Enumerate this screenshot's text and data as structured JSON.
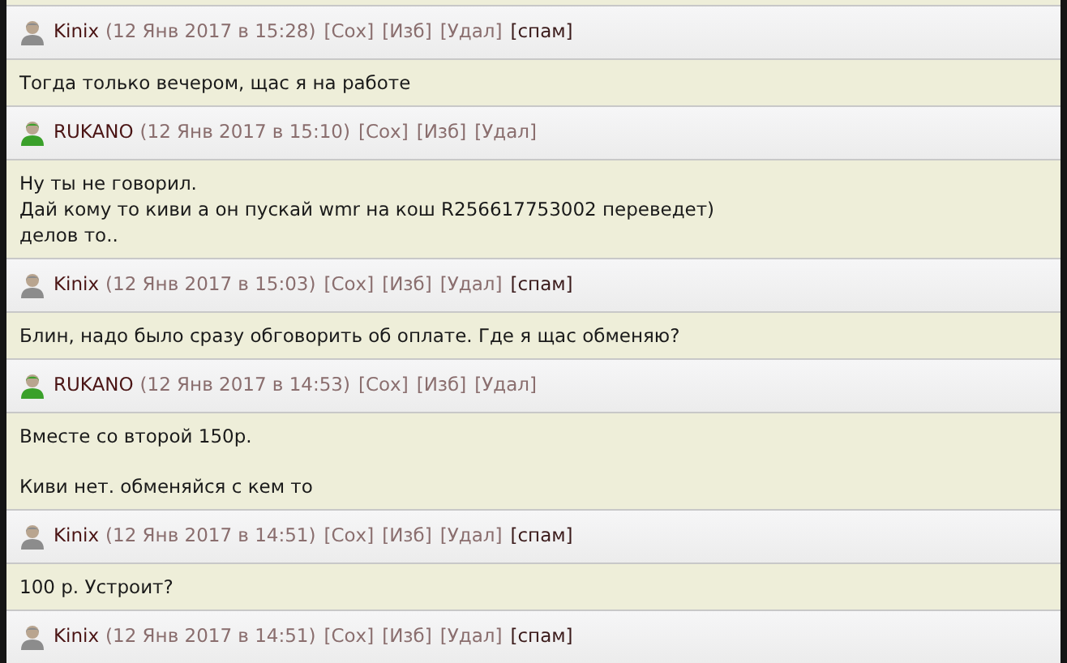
{
  "posts": [
    {
      "author": "Kinix",
      "color": "#8c8c8c",
      "date": "(12 Янв 2017 в 15:28)",
      "actions": [
        {
          "label": "[Сох]",
          "kind": "action"
        },
        {
          "label": "[Изб]",
          "kind": "action"
        },
        {
          "label": "[Удал]",
          "kind": "action"
        },
        {
          "label": "[спам]",
          "kind": "spam"
        }
      ],
      "paragraphs": [
        [
          "Тогда только вечером, щас я на работе"
        ]
      ]
    },
    {
      "author": "RUKANO",
      "color": "#3aa02a",
      "date": "(12 Янв 2017 в 15:10)",
      "actions": [
        {
          "label": "[Сох]",
          "kind": "action"
        },
        {
          "label": "[Изб]",
          "kind": "action"
        },
        {
          "label": "[Удал]",
          "kind": "action"
        }
      ],
      "paragraphs": [
        [
          "Ну ты не говорил.",
          "Дай кому то киви а он пускай wmr на кош R256617753002 переведет)",
          "делов то.."
        ]
      ]
    },
    {
      "author": "Kinix",
      "color": "#8c8c8c",
      "date": "(12 Янв 2017 в 15:03)",
      "actions": [
        {
          "label": "[Сох]",
          "kind": "action"
        },
        {
          "label": "[Изб]",
          "kind": "action"
        },
        {
          "label": "[Удал]",
          "kind": "action"
        },
        {
          "label": "[спам]",
          "kind": "spam"
        }
      ],
      "paragraphs": [
        [
          "Блин, надо было сразу обговорить об оплате. Где я щас обменяю?"
        ]
      ]
    },
    {
      "author": "RUKANO",
      "color": "#3aa02a",
      "date": "(12 Янв 2017 в 14:53)",
      "actions": [
        {
          "label": "[Сох]",
          "kind": "action"
        },
        {
          "label": "[Изб]",
          "kind": "action"
        },
        {
          "label": "[Удал]",
          "kind": "action"
        }
      ],
      "paragraphs": [
        [
          "Вместе со второй 150р."
        ],
        [
          "Киви нет. обменяйся с кем то"
        ]
      ]
    },
    {
      "author": "Kinix",
      "color": "#8c8c8c",
      "date": "(12 Янв 2017 в 14:51)",
      "actions": [
        {
          "label": "[Сох]",
          "kind": "action"
        },
        {
          "label": "[Изб]",
          "kind": "action"
        },
        {
          "label": "[Удал]",
          "kind": "action"
        },
        {
          "label": "[спам]",
          "kind": "spam"
        }
      ],
      "paragraphs": [
        [
          "100 р. Устроит?"
        ]
      ]
    },
    {
      "author": "Kinix",
      "color": "#8c8c8c",
      "date": "(12 Янв 2017 в 14:51)",
      "actions": [
        {
          "label": "[Сох]",
          "kind": "action"
        },
        {
          "label": "[Изб]",
          "kind": "action"
        },
        {
          "label": "[Удал]",
          "kind": "action"
        },
        {
          "label": "[спам]",
          "kind": "spam"
        }
      ]
    }
  ]
}
